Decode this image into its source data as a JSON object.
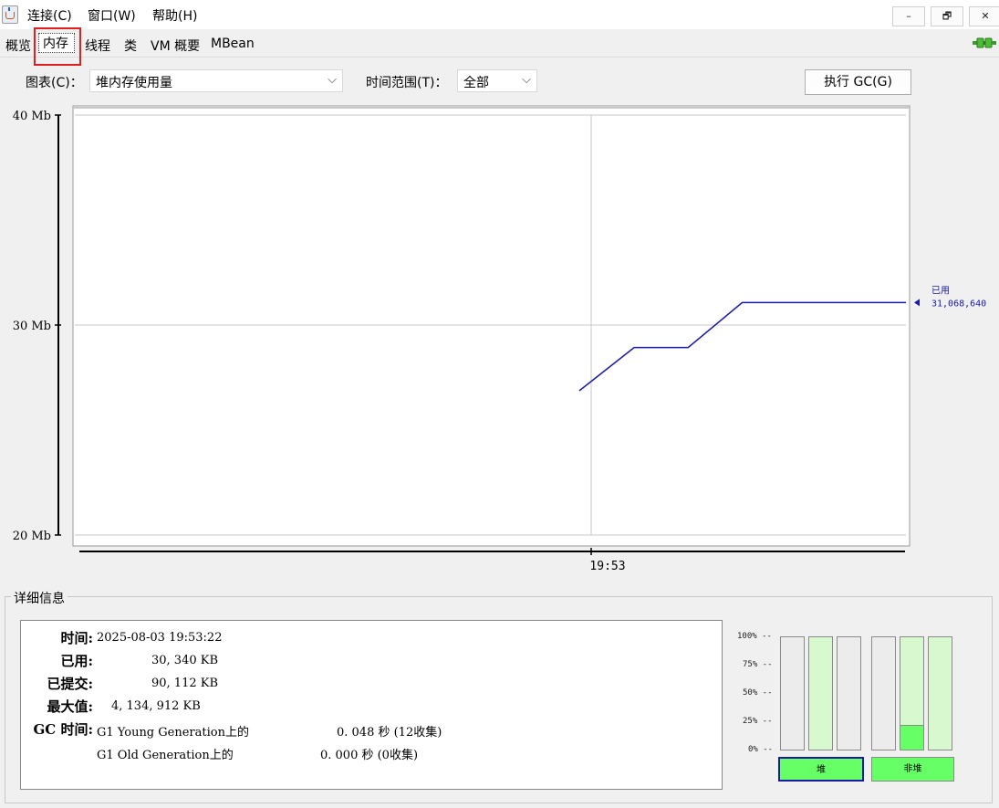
{
  "menu": {
    "connect": "连接(C)",
    "window": "窗口(W)",
    "help": "帮助(H)"
  },
  "window_buttons": {
    "minimize": "–",
    "restore": "🗗",
    "close": "✕"
  },
  "tabs": [
    {
      "label": "概览"
    },
    {
      "label": "内存"
    },
    {
      "label": "线程"
    },
    {
      "label": "类"
    },
    {
      "label": "VM 概要"
    },
    {
      "label": "MBean"
    }
  ],
  "controls": {
    "chart_label": "图表(C)：",
    "chart_value": "堆内存使用量",
    "range_label": "时间范围(T)：",
    "range_value": "全部",
    "gc_button": "执行 GC(G)"
  },
  "chart_data": {
    "type": "line",
    "y_tick_labels": [
      "40 Mb",
      "30 Mb",
      "20 Mb"
    ],
    "y_ticks": [
      40,
      30,
      20
    ],
    "ylim": [
      20,
      40
    ],
    "x_tick_labels": [
      "19:53"
    ],
    "grid": true,
    "series": [
      {
        "name": "已用",
        "color": "#1a1aa8",
        "points": [
          [
            0.607,
            26.87
          ],
          [
            0.673,
            28.93
          ],
          [
            0.738,
            28.93
          ],
          [
            0.803,
            31.07
          ],
          [
            1.0,
            31.07
          ]
        ]
      }
    ],
    "current_label": "已用",
    "current_value": "31,068,640"
  },
  "details": {
    "legend": "详细信息",
    "rows": [
      {
        "key": "时间:",
        "value": "2025-08-03 19:53:22"
      },
      {
        "key": "已用:",
        "value": "30, 340 KB"
      },
      {
        "key": "已提交:",
        "value": "90, 112 KB"
      },
      {
        "key": "最大值:",
        "value": "4, 134, 912 KB"
      }
    ],
    "gc_key": "GC 时间:",
    "gc_young_name": "G1 Young Generation上的",
    "gc_young_value": "0. 048 秒 (12收集)",
    "gc_old_name": "G1 Old Generation上的",
    "gc_old_value": "0. 000 秒 (0收集)"
  },
  "memory_bars": {
    "pct_labels": [
      "100% --",
      "75% --",
      "50% --",
      "25% --",
      "0% --"
    ],
    "heap_label": "堆",
    "nonheap_label": "非堆",
    "heap_pools": [
      {
        "fill": 0.0,
        "color": "#d8f8d0"
      },
      {
        "fill": 1.0,
        "color": "#d8f8d0"
      },
      {
        "fill": 0.0,
        "color": "#d8f8d0"
      }
    ],
    "nonheap_pools": [
      {
        "fill": 0.0,
        "color": "#d8f8d0"
      },
      {
        "fill": 1.0,
        "color": "#d8f8d0",
        "used": 0.22,
        "used_color": "#66ff66"
      },
      {
        "fill": 1.0,
        "color": "#d8f8d0"
      }
    ]
  }
}
